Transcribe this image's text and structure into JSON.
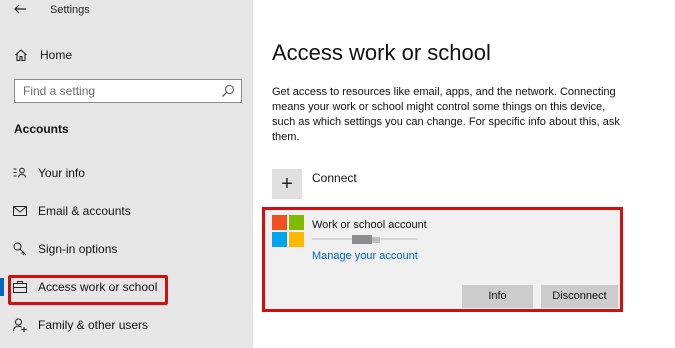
{
  "window": {
    "title": "Settings",
    "back_icon": "back-arrow-icon"
  },
  "sidebar": {
    "home_label": "Home",
    "search_placeholder": "Find a setting",
    "section_title": "Accounts",
    "items": [
      {
        "label": "Your info",
        "icon": "person-card-icon",
        "active": false
      },
      {
        "label": "Email & accounts",
        "icon": "mail-icon",
        "active": false
      },
      {
        "label": "Sign-in options",
        "icon": "key-icon",
        "active": false
      },
      {
        "label": "Access work or school",
        "icon": "briefcase-icon",
        "active": true
      },
      {
        "label": "Family & other users",
        "icon": "person-add-icon",
        "active": false
      }
    ]
  },
  "main": {
    "title": "Access work or school",
    "description": "Get access to resources like email, apps, and the network. Connecting means your work or school might control some things on this device, such as which settings you can change. For specific info about this, ask them.",
    "connect_label": "Connect",
    "account": {
      "title": "Work or school account",
      "manage_link": "Manage your account",
      "info_button": "Info",
      "disconnect_button": "Disconnect"
    }
  },
  "colors": {
    "highlight": "#d20f0f",
    "accent": "#0067c0",
    "ms_red": "#f25022",
    "ms_green": "#7fba00",
    "ms_blue": "#00a4ef",
    "ms_yellow": "#ffb900"
  }
}
